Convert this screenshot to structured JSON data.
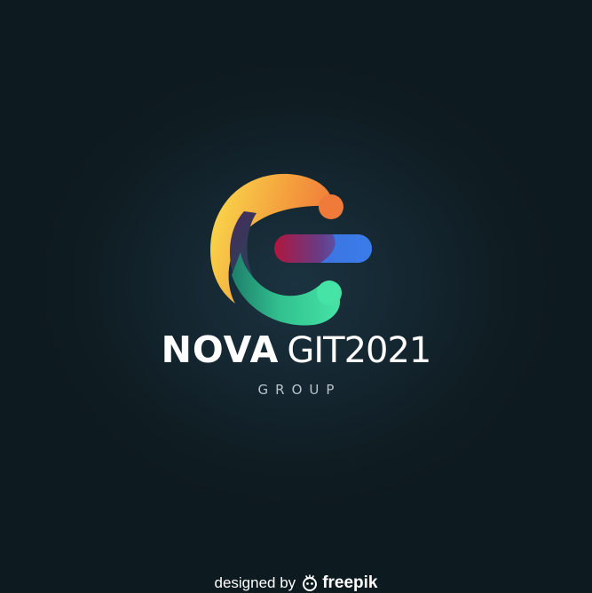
{
  "brand": {
    "name_bold": "NOVA",
    "name_light": "GIT2021",
    "tagline": "GROUP"
  },
  "credit": {
    "prefix": "designed by",
    "brand": "freepik",
    "icon": "freepik-logo-icon"
  },
  "colors": {
    "background": "#0f1c22",
    "gradient_orange": "#f0803c",
    "gradient_yellow": "#f7d44c",
    "gradient_green": "#3ddba0",
    "gradient_crimson": "#b0173e",
    "gradient_blue": "#3a7bea",
    "text": "#ffffff"
  }
}
